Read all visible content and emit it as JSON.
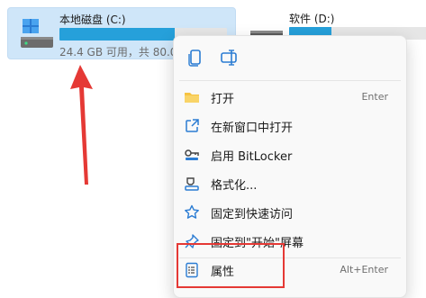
{
  "drives": [
    {
      "name": "本地磁盘 (C:)",
      "free_text": "24.4 GB 可用，共 80.0",
      "usage_fraction": 0.69
    },
    {
      "name": "软件 (D:)",
      "usage_fraction": 0.3
    }
  ],
  "context_menu": {
    "quick_actions": [
      {
        "icon": "copy-icon"
      },
      {
        "icon": "rename-icon"
      }
    ],
    "items": [
      {
        "label": "打开",
        "shortcut": "Enter",
        "icon": "folder-icon"
      },
      {
        "label": "在新窗口中打开",
        "shortcut": "",
        "icon": "open-new-window-icon"
      },
      {
        "label": "启用 BitLocker",
        "shortcut": "",
        "icon": "bitlocker-key-icon"
      },
      {
        "label": "格式化...",
        "shortcut": "",
        "icon": "format-icon"
      },
      {
        "label": "固定到快速访问",
        "shortcut": "",
        "icon": "star-icon"
      },
      {
        "label": "固定到\"开始\"屏幕",
        "shortcut": "",
        "icon": "pin-icon"
      },
      {
        "label": "属性",
        "shortcut": "Alt+Enter",
        "icon": "properties-icon"
      }
    ]
  },
  "colors": {
    "selection": "#cfe6f9",
    "usage_bar": "#26a0da",
    "highlight": "#e53935",
    "arrow": "#e53935",
    "menu_icon_blue": "#2b7cd3",
    "folder_yellow": "#f6c342"
  }
}
